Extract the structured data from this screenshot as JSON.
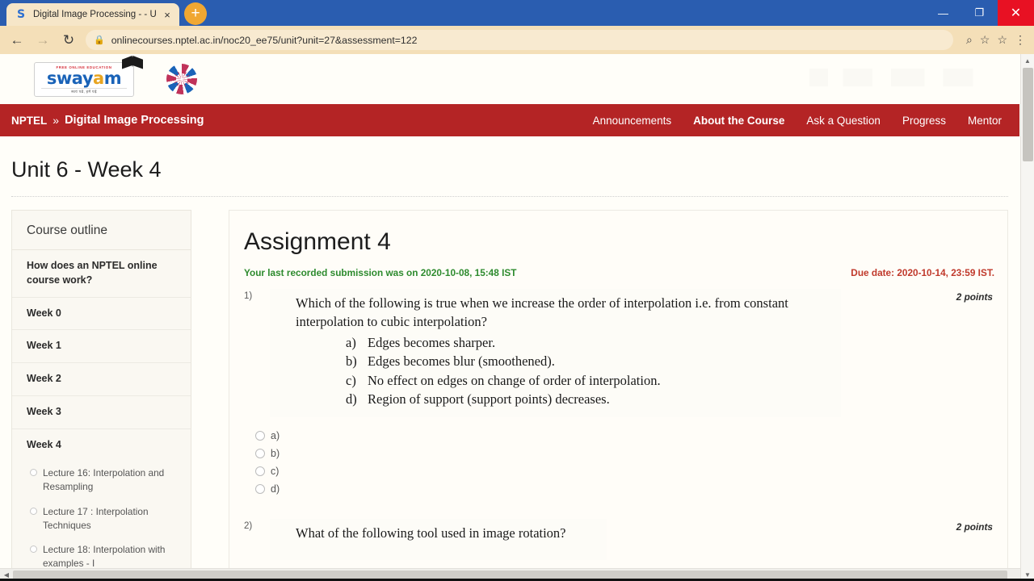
{
  "browser": {
    "tab": {
      "favicon": "swayam-s-favicon",
      "title": "Digital Image Processing - - Unit",
      "close": "×"
    },
    "new_tab": "+",
    "window_controls": {
      "minimize": "—",
      "maximize": "❐",
      "close": "✕"
    },
    "back": "←",
    "forward": "→",
    "reload": "↻",
    "lock": "🔒",
    "url": "onlinecourses.nptel.ac.in/noc20_ee75/unit?unit=27&assessment=122",
    "zoom_icon": "⌕",
    "star_icon": "☆",
    "bookmark_icon": "☆",
    "menu_icon": "⋮"
  },
  "site_header": {
    "logo_tagline": "FREE ONLINE EDUCATION",
    "logo_word_1": "sway",
    "logo_word_2": "a",
    "logo_word_3": "m",
    "logo_sub": "स्वयं पढें, हमें पढ़ें",
    "emblem_name": "government-of-india-emblem"
  },
  "navbar": {
    "brand": "NPTEL",
    "separator": "»",
    "course": "Digital Image Processing",
    "links": [
      {
        "label": "Announcements",
        "active": false
      },
      {
        "label": "About the Course",
        "active": true
      },
      {
        "label": "Ask a Question",
        "active": false
      },
      {
        "label": "Progress",
        "active": false
      },
      {
        "label": "Mentor",
        "active": false
      }
    ]
  },
  "page": {
    "title": "Unit 6 - Week 4"
  },
  "sidebar": {
    "heading": "Course outline",
    "items": [
      {
        "label": "How does an NPTEL online course work?"
      },
      {
        "label": "Week 0"
      },
      {
        "label": "Week 1"
      },
      {
        "label": "Week 2"
      },
      {
        "label": "Week 3"
      },
      {
        "label": "Week 4"
      }
    ],
    "lectures": [
      {
        "label": "Lecture 16: Interpolation and Resampling"
      },
      {
        "label": "Lecture 17 : Interpolation Techniques"
      },
      {
        "label": "Lecture 18: Interpolation with examples - I"
      }
    ]
  },
  "assignment": {
    "title": "Assignment 4",
    "submission_note": "Your last recorded submission was on 2020-10-08, 15:48 IST",
    "due_note": "Due date: 2020-10-14, 23:59 IST.",
    "questions": [
      {
        "number": "1)",
        "points": "2 points",
        "stem": "Which of the following is true when we increase the order of interpolation i.e. from constant interpolation to cubic interpolation?",
        "options": [
          {
            "letter": "a)",
            "text": "Edges becomes sharper."
          },
          {
            "letter": "b)",
            "text": "Edges becomes blur (smoothened)."
          },
          {
            "letter": "c)",
            "text": "No effect on edges on change of order of interpolation."
          },
          {
            "letter": "d)",
            "text": "Region of support (support points) decreases."
          }
        ],
        "choices": [
          {
            "label": "a)",
            "selected": false
          },
          {
            "label": "b)",
            "selected": false
          },
          {
            "label": "c)",
            "selected": false
          },
          {
            "label": "d)",
            "selected": false
          }
        ]
      },
      {
        "number": "2)",
        "points": "2 points",
        "stem": "What of the following tool used in image rotation?",
        "options": [],
        "choices": []
      }
    ]
  },
  "scrollbars": {
    "up_arrow": "▲",
    "down_arrow": "▼",
    "left_arrow": "◀",
    "right_arrow": "▶"
  },
  "colors": {
    "nav_red": "#b42425",
    "browser_blue": "#2a5db0",
    "toolbar_tan": "#f4dfb8",
    "close_red": "#e81123",
    "success_green": "#2e8b2e",
    "due_red": "#c0392b"
  }
}
